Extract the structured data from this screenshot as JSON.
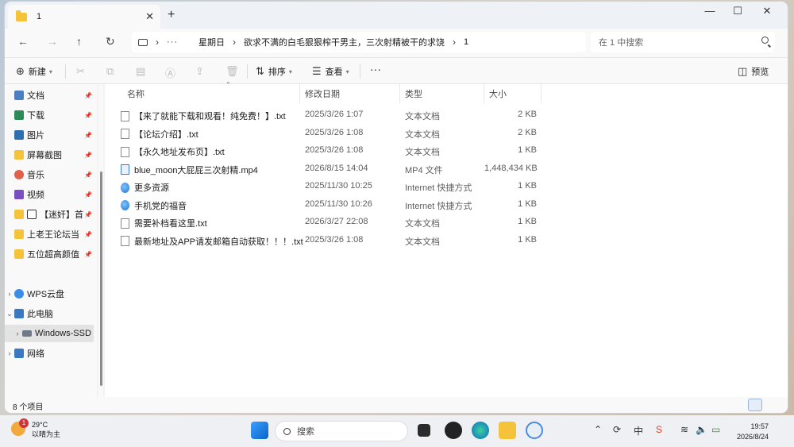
{
  "tab": {
    "title": "1",
    "close": "✕",
    "new": "+"
  },
  "window_controls": {
    "minimize": "—",
    "maximize": "☐",
    "close": "✕"
  },
  "nav": {
    "back": "←",
    "forward": "→",
    "up": "↑",
    "refresh": "↻"
  },
  "address": {
    "more": "···",
    "crumbs": [
      "星期日",
      "欲求不满的白毛狠狠榨干男主，三次射精被干的求饶",
      "1"
    ]
  },
  "search": {
    "placeholder": "在 1 中搜索"
  },
  "toolbar": {
    "new_label": "新建",
    "sort_label": "排序",
    "view_label": "查看",
    "more": "···",
    "preview_label": "预览"
  },
  "sidebar": {
    "items": [
      {
        "label": "文档",
        "color": "#4a7fc1",
        "pinned": true
      },
      {
        "label": "下载",
        "color": "#2e8b57",
        "pinned": true
      },
      {
        "label": "图片",
        "color": "#2f6fb0",
        "pinned": true
      },
      {
        "label": "屏幕截图",
        "color": "#f4c33a",
        "pinned": true
      },
      {
        "label": "音乐",
        "color": "#e0604a",
        "pinned": true
      },
      {
        "label": "视频",
        "color": "#7a4fc1",
        "pinned": true
      },
      {
        "label": "【迷奸】首",
        "color": "#f4c33a",
        "pinned": true
      },
      {
        "label": "上老王论坛当",
        "color": "#f4c33a",
        "pinned": true
      },
      {
        "label": "五位超高颜值",
        "color": "#f4c33a",
        "pinned": true
      }
    ],
    "tree": [
      {
        "label": "WPS云盘",
        "expander": "›",
        "color": "#3a8ee6"
      },
      {
        "label": "此电脑",
        "expander": "⌄",
        "color": "#3a78c2"
      },
      {
        "label": "Windows-SSD",
        "expander": "›",
        "color": "#6c7a89"
      },
      {
        "label": "网络",
        "expander": "›",
        "color": "#3a78c2"
      }
    ]
  },
  "columns": {
    "name": "名称",
    "date": "修改日期",
    "type": "类型",
    "size": "大小"
  },
  "files": [
    {
      "name": "【来了就能下载和观看！纯免费！】.txt",
      "date": "2025/3/26 1:07",
      "type": "文本文档",
      "size": "2 KB",
      "icon": "txt"
    },
    {
      "name": "【论坛介绍】.txt",
      "date": "2025/3/26 1:08",
      "type": "文本文档",
      "size": "2 KB",
      "icon": "txt"
    },
    {
      "name": "【永久地址发布页】.txt",
      "date": "2025/3/26 1:08",
      "type": "文本文档",
      "size": "1 KB",
      "icon": "txt"
    },
    {
      "name": "blue_moon大屁屁三次射精.mp4",
      "date": "2026/8/15 14:04",
      "type": "MP4 文件",
      "size": "1,448,434 KB",
      "icon": "mp4"
    },
    {
      "name": "更多资源",
      "date": "2025/11/30 10:25",
      "type": "Internet 快捷方式",
      "size": "1 KB",
      "icon": "url"
    },
    {
      "name": "手机党的福音",
      "date": "2025/11/30 10:26",
      "type": "Internet 快捷方式",
      "size": "1 KB",
      "icon": "url"
    },
    {
      "name": "需要补档看这里.txt",
      "date": "2026/3/27 22:08",
      "type": "文本文档",
      "size": "1 KB",
      "icon": "txt"
    },
    {
      "name": "最新地址及APP请发邮箱自动获取！！！.txt",
      "date": "2025/3/26 1:08",
      "type": "文本文档",
      "size": "1 KB",
      "icon": "txt"
    }
  ],
  "status": {
    "count": "8 个项目"
  },
  "taskbar": {
    "weather_temp": "29°C",
    "weather_desc": "以晴为主",
    "weather_badge": "1",
    "search_label": "搜索",
    "tray_lang": "中",
    "time": "19:57",
    "date": "2026/8/24"
  }
}
